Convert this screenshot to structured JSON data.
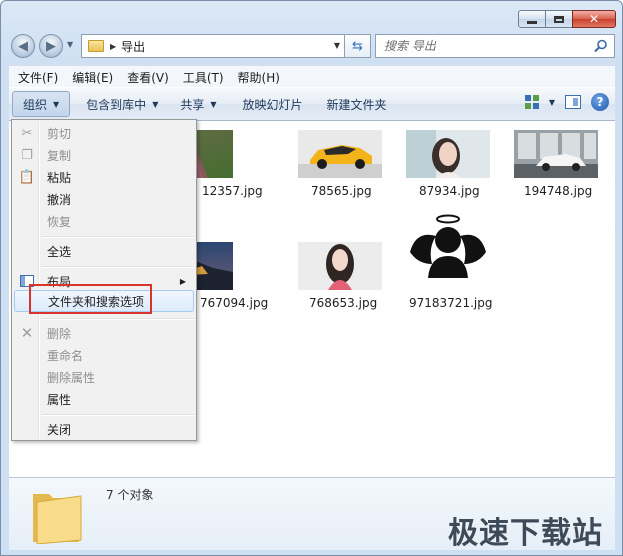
{
  "window": {
    "title_bar_buttons": [
      "minimize",
      "maximize",
      "close"
    ]
  },
  "navigation": {
    "address_path": "导出",
    "search_placeholder": "搜索 导出"
  },
  "menubar": {
    "items": [
      "文件(F)",
      "编辑(E)",
      "查看(V)",
      "工具(T)",
      "帮助(H)"
    ]
  },
  "toolbar": {
    "organize": "组织",
    "include_library": "包含到库中",
    "share": "共享",
    "slideshow": "放映幻灯片",
    "new_folder": "新建文件夹"
  },
  "files": [
    {
      "name": "12357.jpg",
      "kind": "flower-field"
    },
    {
      "name": "78565.jpg",
      "kind": "yellow-car"
    },
    {
      "name": "87934.jpg",
      "kind": "portrait"
    },
    {
      "name": "194748.jpg",
      "kind": "white-car"
    },
    {
      "name": "767094.jpg",
      "kind": "night-castle"
    },
    {
      "name": "768653.jpg",
      "kind": "portrait-2"
    },
    {
      "name": "97183721.jpg",
      "kind": "angel-avatar"
    }
  ],
  "context_menu": {
    "cut": "剪切",
    "copy": "复制",
    "paste": "粘贴",
    "undo": "撤消",
    "redo": "恢复",
    "select_all": "全选",
    "layout": "布局",
    "folder_options": "文件夹和搜索选项",
    "delete": "删除",
    "rename": "重命名",
    "remove_properties": "删除属性",
    "properties": "属性",
    "close": "关闭"
  },
  "details": {
    "item_count": "7 个对象"
  },
  "watermark": "极速下载站",
  "colors": {
    "highlight_box": "#d9342b",
    "toolbar_text": "#1e395b",
    "disabled_text": "#8f8f8f"
  }
}
